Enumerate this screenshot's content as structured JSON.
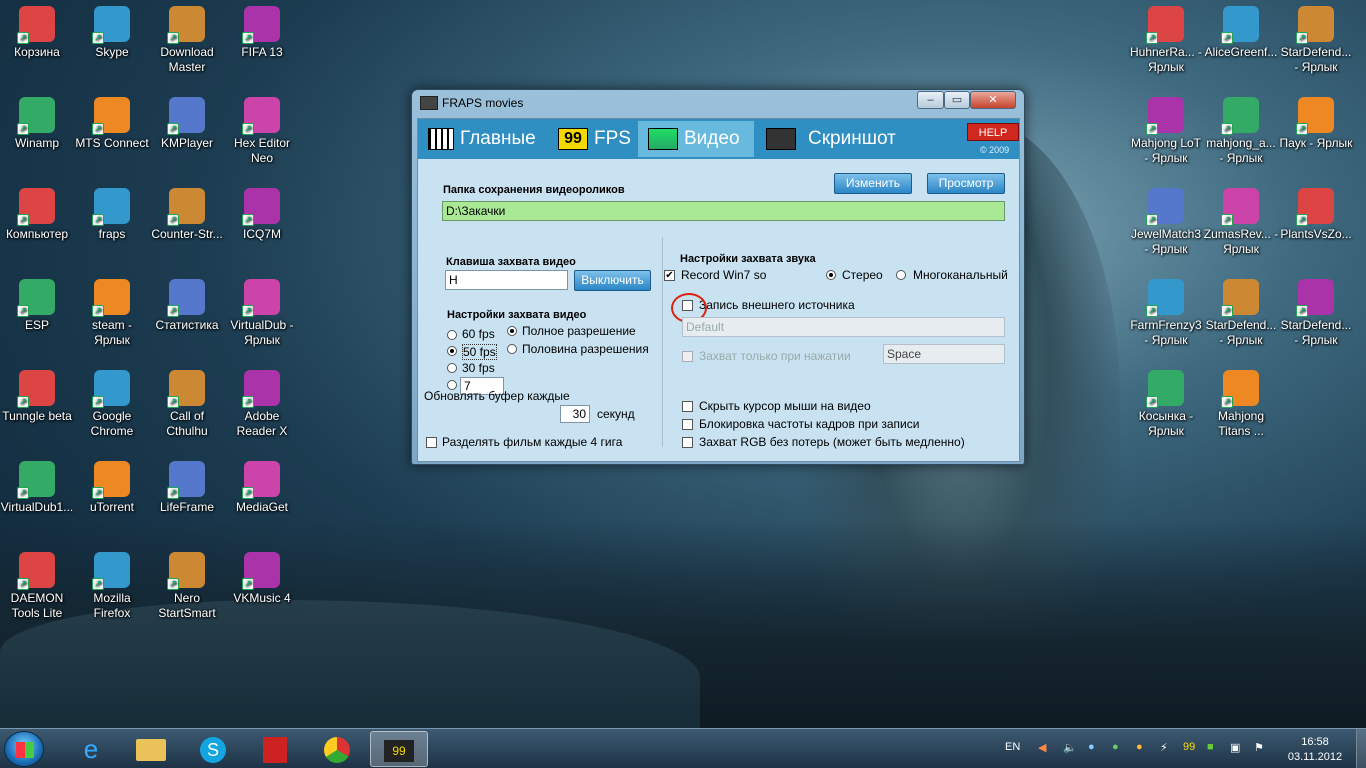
{
  "desktop": {
    "left_icons": [
      {
        "label": "Корзина",
        "icon": "recycle-bin-icon"
      },
      {
        "label": "Skype",
        "icon": "skype-icon"
      },
      {
        "label": "Download Master",
        "icon": "download-master-icon"
      },
      {
        "label": "FIFA 13",
        "icon": "fifa-icon"
      },
      {
        "label": "Winamp",
        "icon": "winamp-icon"
      },
      {
        "label": "MTS Connect",
        "icon": "mts-icon"
      },
      {
        "label": "KMPlayer",
        "icon": "kmplayer-icon"
      },
      {
        "label": "Hex Editor Neo",
        "icon": "hex-editor-icon"
      },
      {
        "label": "Компьютер",
        "icon": "computer-icon"
      },
      {
        "label": "fraps",
        "icon": "folder-icon"
      },
      {
        "label": "Counter-Str...",
        "icon": "counter-strike-icon"
      },
      {
        "label": "ICQ7M",
        "icon": "icq-icon"
      },
      {
        "label": "ESP",
        "icon": "esp-icon"
      },
      {
        "label": "steam - Ярлык",
        "icon": "steam-icon"
      },
      {
        "label": "Статистика",
        "icon": "statistics-icon"
      },
      {
        "label": "VirtualDub - Ярлык",
        "icon": "virtualdub-icon"
      },
      {
        "label": "Tunngle beta",
        "icon": "tunngle-icon"
      },
      {
        "label": "Google Chrome",
        "icon": "chrome-icon"
      },
      {
        "label": "Call of Cthulhu",
        "icon": "cthulhu-icon"
      },
      {
        "label": "Adobe Reader X",
        "icon": "adobe-reader-icon"
      },
      {
        "label": "VirtualDub1...",
        "icon": "folder-icon"
      },
      {
        "label": "uTorrent",
        "icon": "utorrent-icon"
      },
      {
        "label": "LifeFrame",
        "icon": "lifeframe-icon"
      },
      {
        "label": "MediaGet",
        "icon": "mediaget-icon"
      },
      {
        "label": "DAEMON Tools Lite",
        "icon": "daemon-tools-icon"
      },
      {
        "label": "Mozilla Firefox",
        "icon": "firefox-icon"
      },
      {
        "label": "Nero StartSmart",
        "icon": "nero-icon"
      },
      {
        "label": "VKMusic 4",
        "icon": "vkmusic-icon"
      }
    ],
    "right_icons": [
      {
        "label": "HuhnerRa... - Ярлык",
        "icon": "chicken-icon"
      },
      {
        "label": "AliceGreenf...",
        "icon": "alice-icon"
      },
      {
        "label": "StarDefend... - Ярлык",
        "icon": "stardefender-icon"
      },
      {
        "label": "Mahjong LoT - Ярлык",
        "icon": "mahjong-icon"
      },
      {
        "label": "mahjong_a... - Ярлык",
        "icon": "mahjong-icon"
      },
      {
        "label": "Паук - Ярлык",
        "icon": "spider-icon"
      },
      {
        "label": "JewelMatch3 - Ярлык",
        "icon": "jewelmatch-icon"
      },
      {
        "label": "ZumasRev... - Ярлык",
        "icon": "zuma-icon"
      },
      {
        "label": "PlantsVsZo...",
        "icon": "plants-icon"
      },
      {
        "label": "FarmFrenzy3 - Ярлык",
        "icon": "farmfrenzy-icon"
      },
      {
        "label": "StarDefend... - Ярлык",
        "icon": "stardefender-icon"
      },
      {
        "label": "StarDefend... - Ярлык",
        "icon": "stardefender-icon"
      },
      {
        "label": "Косынка - Ярлык",
        "icon": "solitaire-icon"
      },
      {
        "label": "Mahjong Titans ...",
        "icon": "mahjong-icon"
      }
    ]
  },
  "window": {
    "title": "FRAPS movies",
    "tabs": [
      {
        "label": "Главные"
      },
      {
        "label": "FPS"
      },
      {
        "label": "Видео"
      },
      {
        "label": "Скриншот"
      }
    ],
    "help_label": "HELP",
    "copyright": "© 2009",
    "change_button": "Изменить",
    "browse_button": "Просмотр",
    "folder_label": "Папка сохранения видеороликов",
    "folder_value": "D:\\Закачки",
    "hotkey_label": "Клавиша захвата видео",
    "hotkey_value": "H",
    "disable_button": "Выключить",
    "video_settings_label": "Настройки захвата видео",
    "fps_options": [
      "60 fps",
      "50 fps",
      "30 fps"
    ],
    "custom_fps": "7",
    "full_res": "Полное разрешение",
    "half_res": "Половина разрешения",
    "buffer_label": "Обновлять буфер каждые",
    "buffer_value": "30",
    "seconds_label": "секунд",
    "split_label": "Разделять фильм каждые 4 гига",
    "audio_settings_label": "Настройки захвата звука",
    "record_win7": "Record Win7 so",
    "stereo": "Стерео",
    "multichannel": "Многоканальный",
    "external_label": "Запись внешнего источника",
    "device_value": "Default",
    "push_to_talk": "Захват только при нажатии",
    "push_key": "Space",
    "hide_cursor": "Скрыть курсор мыши на видео",
    "lock_fps": "Блокировка частоты кадров при записи",
    "rgb_lossless": "Захват RGB без потерь (может быть медленно)"
  },
  "taskbar": {
    "language": "EN",
    "time": "16:58",
    "date": "03.11.2012"
  }
}
